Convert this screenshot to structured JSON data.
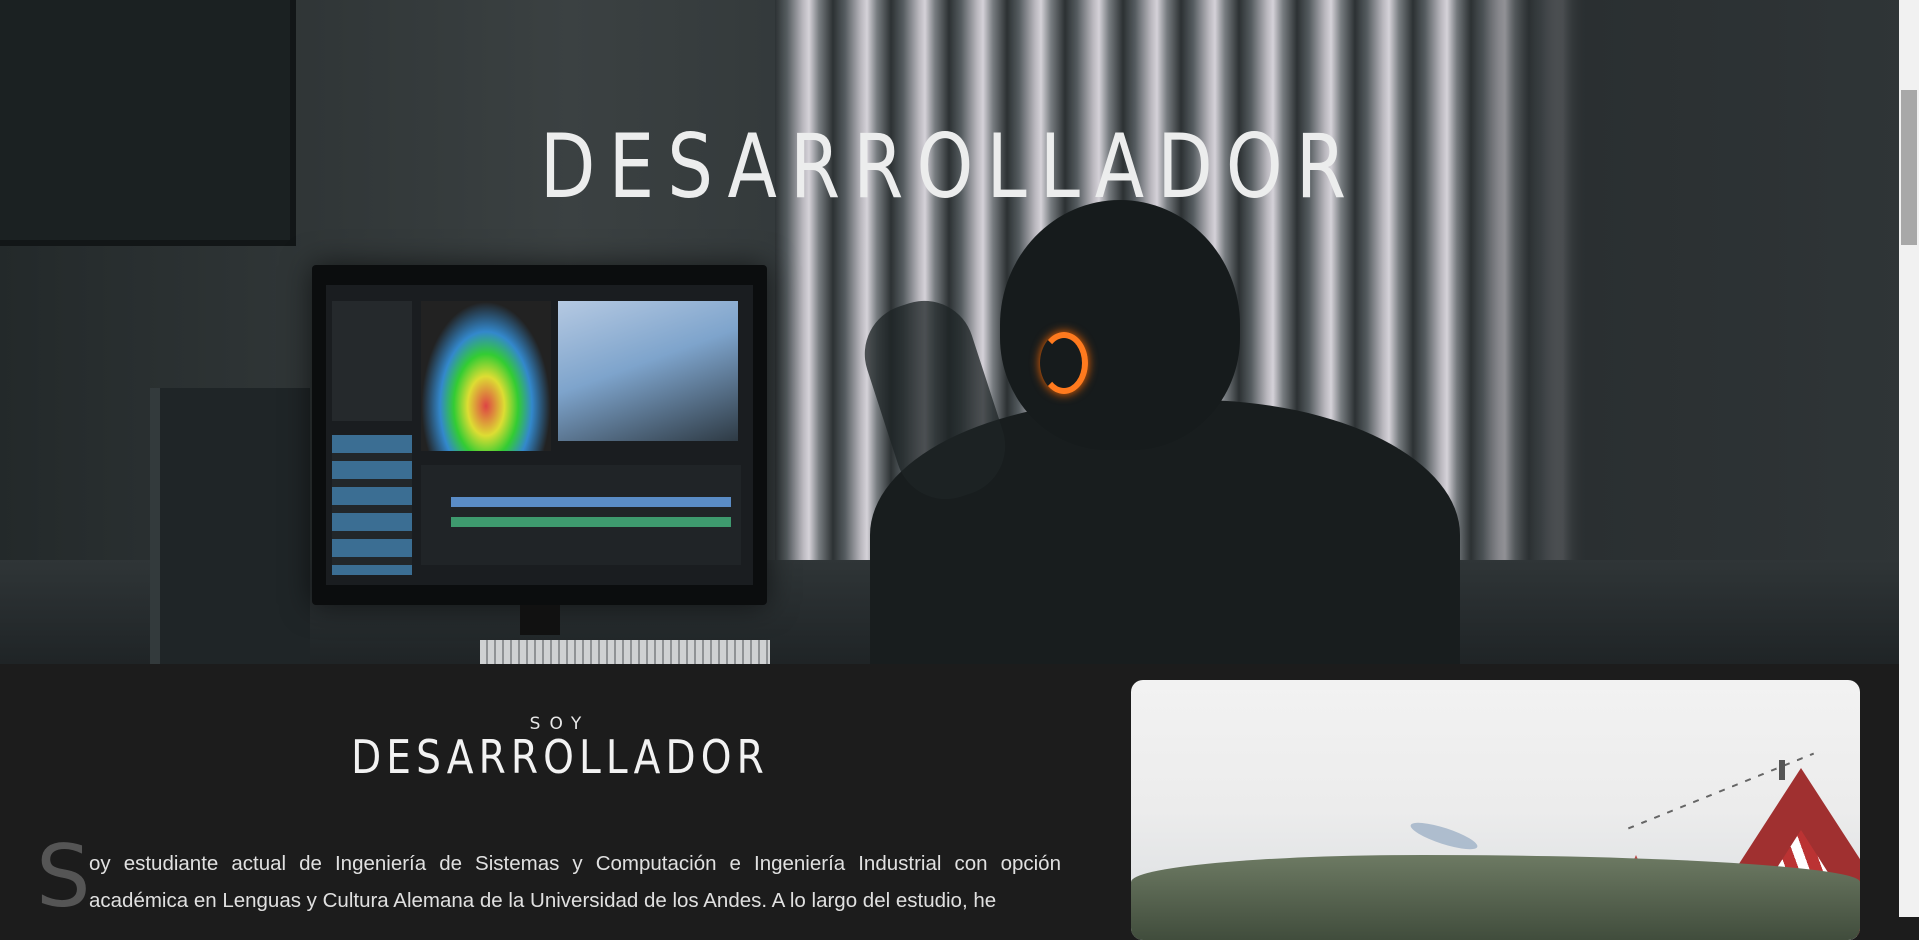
{
  "hero": {
    "title": "DESARROLLADOR"
  },
  "about": {
    "kicker": "SOY",
    "title": "DESARROLLADOR",
    "dropcap": "S",
    "text": "oy estudiante actual de Ingeniería de Sistemas y Computación e Ingeniería Industrial con opción académica en Lenguas y Cultura Alemana de la Universidad de los Andes. A lo largo del estudio, he"
  },
  "colors": {
    "background": "#1c1c1c",
    "text": "#e0e0e0",
    "accent_light": "#ff7a1e"
  }
}
